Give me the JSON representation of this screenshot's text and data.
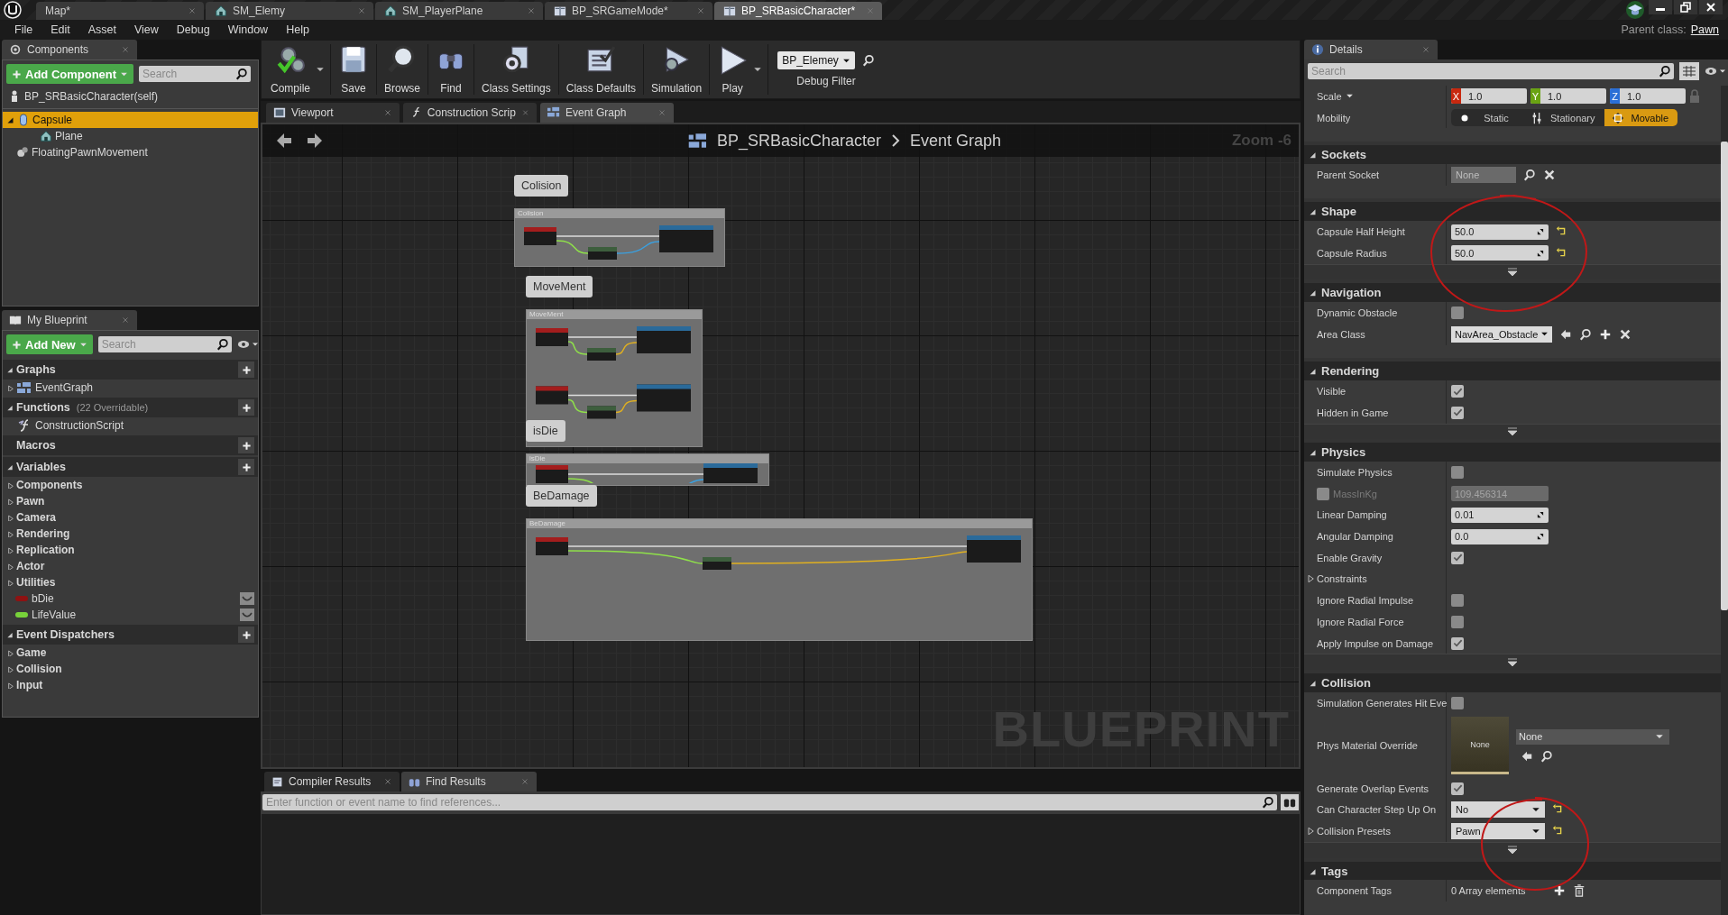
{
  "doc_tabs": [
    {
      "label": "Map*",
      "kind": "none",
      "selected": false
    },
    {
      "label": "SM_Elemy",
      "kind": "mesh",
      "selected": false
    },
    {
      "label": "SM_PlayerPlane",
      "kind": "mesh",
      "selected": false
    },
    {
      "label": "BP_SRGameMode*",
      "kind": "blueprint",
      "selected": false
    },
    {
      "label": "BP_SRBasicCharacter*",
      "kind": "blueprint",
      "selected": true
    }
  ],
  "menu": [
    "File",
    "Edit",
    "Asset",
    "View",
    "Debug",
    "Window",
    "Help"
  ],
  "parent_class": {
    "label": "Parent class:",
    "value": "Pawn"
  },
  "components_panel": {
    "title": "Components",
    "add_button": "Add Component",
    "search": {
      "placeholder": "Search"
    },
    "self_item": "BP_SRBasicCharacter(self)",
    "tree": [
      {
        "label": "Capsule",
        "kind": "capsule",
        "selected": true,
        "expanded": true,
        "children": [
          {
            "label": "Plane",
            "kind": "mesh",
            "selected": false
          }
        ]
      },
      {
        "label": "FloatingPawnMovement",
        "kind": "movement",
        "selected": false
      }
    ]
  },
  "my_blueprint": {
    "title": "My Blueprint",
    "add_button": "Add New",
    "search": {
      "placeholder": "Search"
    },
    "sections": [
      {
        "title": "Graphs",
        "expanded": true,
        "items": [
          {
            "label": "EventGraph",
            "kind": "graph",
            "expanded": false
          }
        ]
      },
      {
        "title": "Functions",
        "note": "(22 Overridable)",
        "expanded": true,
        "items": [
          {
            "label": "ConstructionScript",
            "kind": "function"
          }
        ]
      },
      {
        "title": "Macros"
      },
      {
        "title": "Variables",
        "expanded": true,
        "items": [
          {
            "label": "Components",
            "kind": "category",
            "expanded": false
          },
          {
            "label": "Pawn",
            "kind": "category",
            "expanded": false
          },
          {
            "label": "Camera",
            "kind": "category",
            "expanded": false
          },
          {
            "label": "Rendering",
            "kind": "category",
            "expanded": false
          },
          {
            "label": "Replication",
            "kind": "category",
            "expanded": false
          },
          {
            "label": "Actor",
            "kind": "category",
            "expanded": false
          },
          {
            "label": "Utilities",
            "kind": "category",
            "expanded": false
          },
          {
            "label": "bDie",
            "kind": "variable",
            "color": "#8e1212"
          },
          {
            "label": "LifeValue",
            "kind": "variable",
            "color": "#78d23a"
          }
        ]
      },
      {
        "title": "Event Dispatchers",
        "expanded": true,
        "items": [
          {
            "label": "Game",
            "kind": "category",
            "expanded": false
          },
          {
            "label": "Collision",
            "kind": "category",
            "expanded": false
          },
          {
            "label": "Input",
            "kind": "category",
            "expanded": false
          }
        ]
      }
    ]
  },
  "toolbar": {
    "buttons": [
      {
        "label": "Compile",
        "kind": "compile",
        "dropdown": true
      },
      {
        "label": "Save",
        "kind": "save",
        "dropdown": false
      },
      {
        "label": "Browse",
        "kind": "browse",
        "dropdown": false
      },
      {
        "label": "Find",
        "kind": "find",
        "dropdown": false
      },
      {
        "label": "Class Settings",
        "kind": "settings",
        "dropdown": false
      },
      {
        "label": "Class Defaults",
        "kind": "defaults",
        "dropdown": false
      },
      {
        "label": "Simulation",
        "kind": "simulation",
        "dropdown": false
      },
      {
        "label": "Play",
        "kind": "play",
        "dropdown": true
      }
    ],
    "debug_filter": {
      "value": "BP_Elemey",
      "label": "Debug Filter"
    }
  },
  "graph_tabs": [
    {
      "label": "Viewport",
      "kind": "viewport",
      "selected": false
    },
    {
      "label": "Construction Scrip",
      "kind": "function",
      "selected": false
    },
    {
      "label": "Event Graph",
      "kind": "graph",
      "selected": true
    }
  ],
  "graph": {
    "breadcrumb": [
      "BP_SRBasicCharacter",
      "Event Graph"
    ],
    "zoom": "Zoom -6",
    "watermark": "BLUEPRINT",
    "comments": [
      {
        "label": "Colision",
        "header": "Colision"
      },
      {
        "label": "MoveMent",
        "header": "MoveMent"
      },
      {
        "label": "isDie",
        "header": "isDie"
      },
      {
        "label": "BeDamage",
        "header": "BeDamage"
      }
    ]
  },
  "bottom": {
    "tabs": [
      {
        "label": "Compiler Results",
        "selected": false
      },
      {
        "label": "Find Results",
        "selected": true
      }
    ],
    "search": {
      "placeholder": "Enter function or event name to find references..."
    }
  },
  "details": {
    "title": "Details",
    "search": {
      "placeholder": "Search"
    },
    "sections": [
      {
        "rows": [
          {
            "label": "Scale",
            "kind": "vector",
            "values": [
              {
                "axis": "X",
                "value": "1.0",
                "color": "#c8280f"
              },
              {
                "axis": "Y",
                "value": "1.0",
                "color": "#6aa313"
              },
              {
                "axis": "Z",
                "value": "1.0",
                "color": "#2b6fd6"
              }
            ]
          },
          {
            "label": "Mobility",
            "kind": "mobility",
            "options": [
              {
                "label": "Static",
                "selected": false
              },
              {
                "label": "Stationary",
                "selected": false
              },
              {
                "label": "Movable",
                "selected": true
              }
            ]
          }
        ]
      },
      {
        "title": "Sockets",
        "expanded": true,
        "rows": [
          {
            "label": "Parent Socket",
            "kind": "socket",
            "value": "None"
          }
        ]
      },
      {
        "title": "Shape",
        "expanded": true,
        "advanced": true,
        "rows": [
          {
            "label": "Capsule Half Height",
            "kind": "number",
            "value": "50.0",
            "reset": true
          },
          {
            "label": "Capsule Radius",
            "kind": "number",
            "value": "50.0",
            "reset": true
          }
        ]
      },
      {
        "title": "Navigation",
        "expanded": true,
        "rows": [
          {
            "label": "Dynamic Obstacle",
            "kind": "checkbox",
            "checked": false
          },
          {
            "label": "Area Class",
            "kind": "class",
            "value": "NavArea_Obstacle"
          }
        ]
      },
      {
        "title": "Rendering",
        "expanded": true,
        "advanced": true,
        "rows": [
          {
            "label": "Visible",
            "kind": "checkbox",
            "checked": true
          },
          {
            "label": "Hidden in Game",
            "kind": "checkbox",
            "checked": true
          }
        ]
      },
      {
        "title": "Physics",
        "expanded": true,
        "advanced": true,
        "rows": [
          {
            "label": "Simulate Physics",
            "kind": "checkbox",
            "checked": false
          },
          {
            "label": "MassInKg",
            "kind": "override",
            "checked": false,
            "value": "109.456314"
          },
          {
            "label": "Linear Damping",
            "kind": "number",
            "value": "0.01",
            "reset": false
          },
          {
            "label": "Angular Damping",
            "kind": "number",
            "value": "0.0",
            "reset": false
          },
          {
            "label": "Enable Gravity",
            "kind": "checkbox",
            "checked": true
          },
          {
            "label": "Constraints",
            "kind": "group",
            "expanded": false
          },
          {
            "label": "Ignore Radial Impulse",
            "kind": "checkbox",
            "checked": false
          },
          {
            "label": "Ignore Radial Force",
            "kind": "checkbox",
            "checked": false
          },
          {
            "label": "Apply Impulse on Damage",
            "kind": "checkbox",
            "checked": true
          }
        ]
      },
      {
        "title": "Collision",
        "expanded": true,
        "advanced": true,
        "rows": [
          {
            "label": "Simulation Generates Hit Eve",
            "kind": "checkbox",
            "checked": false
          },
          {
            "label": "Phys Material Override",
            "kind": "material",
            "thumb": "None",
            "value": "None"
          },
          {
            "label": "Generate Overlap Events",
            "kind": "checkbox",
            "checked": true
          },
          {
            "label": "Can Character Step Up On",
            "kind": "dropdown",
            "value": "No",
            "reset": true
          },
          {
            "label": "Collision Presets",
            "kind": "dropdown",
            "value": "Pawn",
            "reset": true,
            "expanded": false
          }
        ]
      },
      {
        "title": "Tags",
        "expanded": true,
        "rows": [
          {
            "label": "Component Tags",
            "kind": "array",
            "value": "0 Array elements"
          }
        ]
      }
    ]
  }
}
